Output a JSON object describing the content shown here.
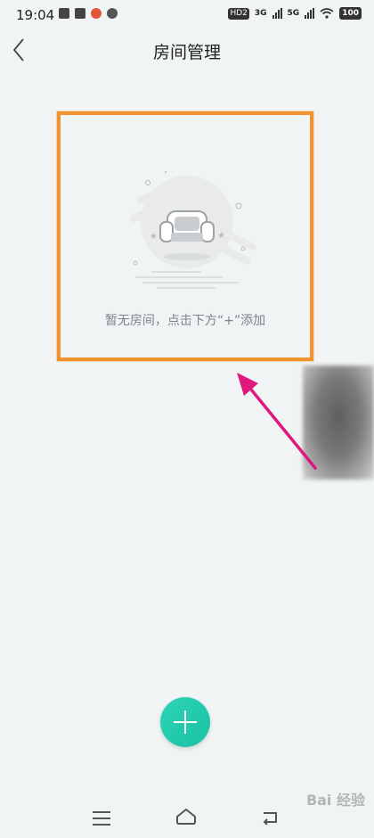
{
  "status_bar": {
    "time": "19:04",
    "hd_badge": "HD2",
    "net1": "3G",
    "net2": "5G",
    "battery": "100"
  },
  "header": {
    "title": "房间管理"
  },
  "empty_state": {
    "message": "暂无房间，点击下方“+”添加"
  },
  "watermark": {
    "text": "Bai 经验"
  },
  "icons": {
    "back": "chevron-left-icon",
    "add": "plus-icon",
    "sofa": "sofa-icon",
    "nav_menu": "menu-icon",
    "nav_home": "home-icon",
    "nav_back": "back-icon"
  },
  "colors": {
    "accent": "#1ec8a8",
    "highlight_border": "#f0922e",
    "annotation_arrow": "#e0187d"
  }
}
